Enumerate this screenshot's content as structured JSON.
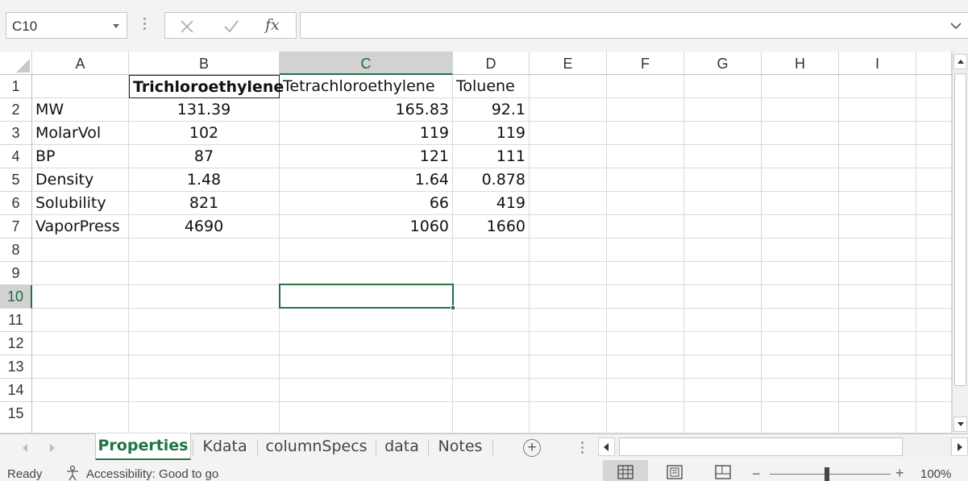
{
  "formula_bar": {
    "name_box": "C10",
    "cancel_icon": "close-icon",
    "enter_icon": "check-icon",
    "fx_label": "fx",
    "formula": ""
  },
  "columns": [
    "A",
    "B",
    "C",
    "D",
    "E",
    "F",
    "G",
    "H",
    "I"
  ],
  "active_column": "C",
  "rows": [
    "1",
    "2",
    "3",
    "4",
    "5",
    "6",
    "7",
    "8",
    "9",
    "10",
    "11",
    "12",
    "13",
    "14",
    "15"
  ],
  "active_row": "10",
  "cells": {
    "B1": "Trichloroethylene",
    "C1": "Tetrachloroethylene",
    "D1": "Toluene",
    "A2": "MW",
    "B2": "131.39",
    "C2": "165.83",
    "D2": "92.1",
    "A3": "MolarVol",
    "B3": "102",
    "C3": "119",
    "D3": "119",
    "A4": "BP",
    "B4": "87",
    "C4": "121",
    "D4": "111",
    "A5": "Density",
    "B5": "1.48",
    "C5": "1.64",
    "D5": "0.878",
    "A6": "Solubility",
    "B6": "821",
    "C6": "66",
    "D6": "419",
    "A7": "VaporPress",
    "B7": "4690",
    "C7": "1060",
    "D7": "1660"
  },
  "sheet_tabs": [
    {
      "label": "Properties",
      "active": true
    },
    {
      "label": "Kdata",
      "active": false
    },
    {
      "label": "columnSpecs",
      "active": false
    },
    {
      "label": "data",
      "active": false
    },
    {
      "label": "Notes",
      "active": false
    }
  ],
  "add_sheet_label": "+",
  "status": {
    "ready": "Ready",
    "accessibility": "Accessibility: Good to go",
    "zoom_minus": "−",
    "zoom_plus": "+",
    "zoom": "100%",
    "zoom_fraction": 0.47
  },
  "colors": {
    "accent": "#217346",
    "header_active_bg": "#d2d2d2",
    "gridline": "#dadada"
  }
}
